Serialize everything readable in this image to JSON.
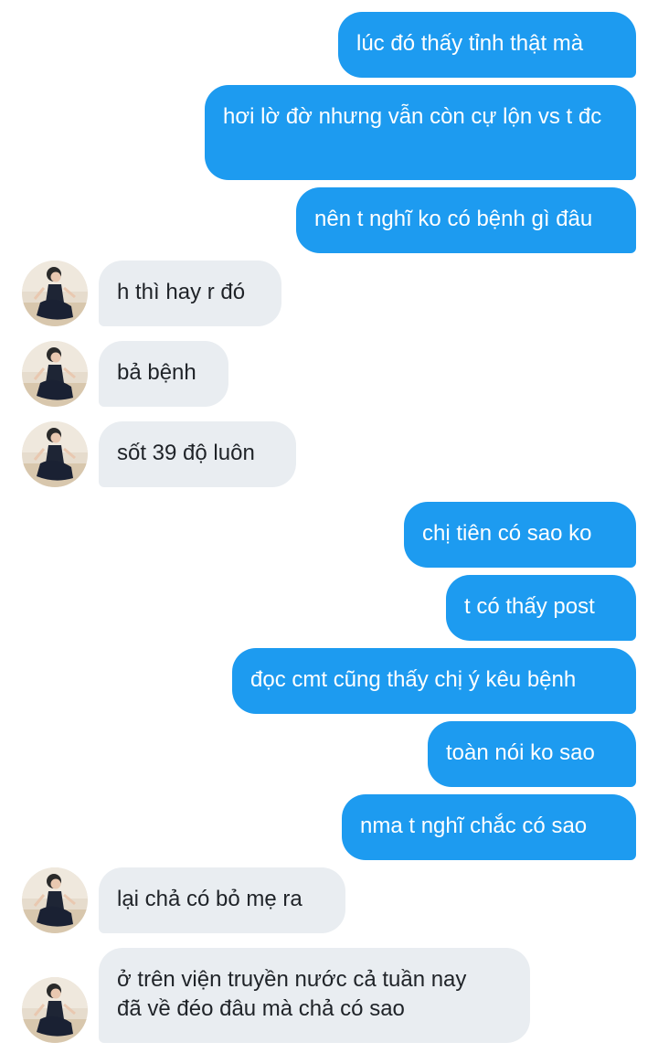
{
  "messages": [
    {
      "side": "out",
      "text": "lúc đó thấy tỉnh thật mà"
    },
    {
      "side": "out",
      "text": "hơi lờ đờ nhưng vẫn còn cự lộn vs t đc"
    },
    {
      "side": "out",
      "text": "nên t nghĩ ko có bệnh gì đâu"
    },
    {
      "side": "in",
      "text": "h thì hay r đó",
      "avatar": "contact-avatar"
    },
    {
      "side": "in",
      "text": "bả bệnh",
      "avatar": "contact-avatar"
    },
    {
      "side": "in",
      "text": "sốt 39 độ luôn",
      "avatar": "contact-avatar"
    },
    {
      "side": "out",
      "text": "chị tiên có sao ko"
    },
    {
      "side": "out",
      "text": "t có thấy post"
    },
    {
      "side": "out",
      "text": "đọc cmt cũng thấy chị ý kêu bệnh"
    },
    {
      "side": "out",
      "text": "toàn nói ko sao"
    },
    {
      "side": "out",
      "text": "nma t nghĩ chắc có sao"
    },
    {
      "side": "in",
      "text": "lại chả có bỏ mẹ ra",
      "avatar": "contact-avatar"
    },
    {
      "side": "in",
      "text": "ở trên viện truyền nước cả tuần nay\nđã về đéo đâu mà chả có sao",
      "avatar": "contact-avatar"
    }
  ],
  "colors": {
    "outgoing_bubble": "#1d9bf0",
    "incoming_bubble": "#e9edf1",
    "outgoing_text": "#ffffff",
    "incoming_text": "#1f2328"
  }
}
